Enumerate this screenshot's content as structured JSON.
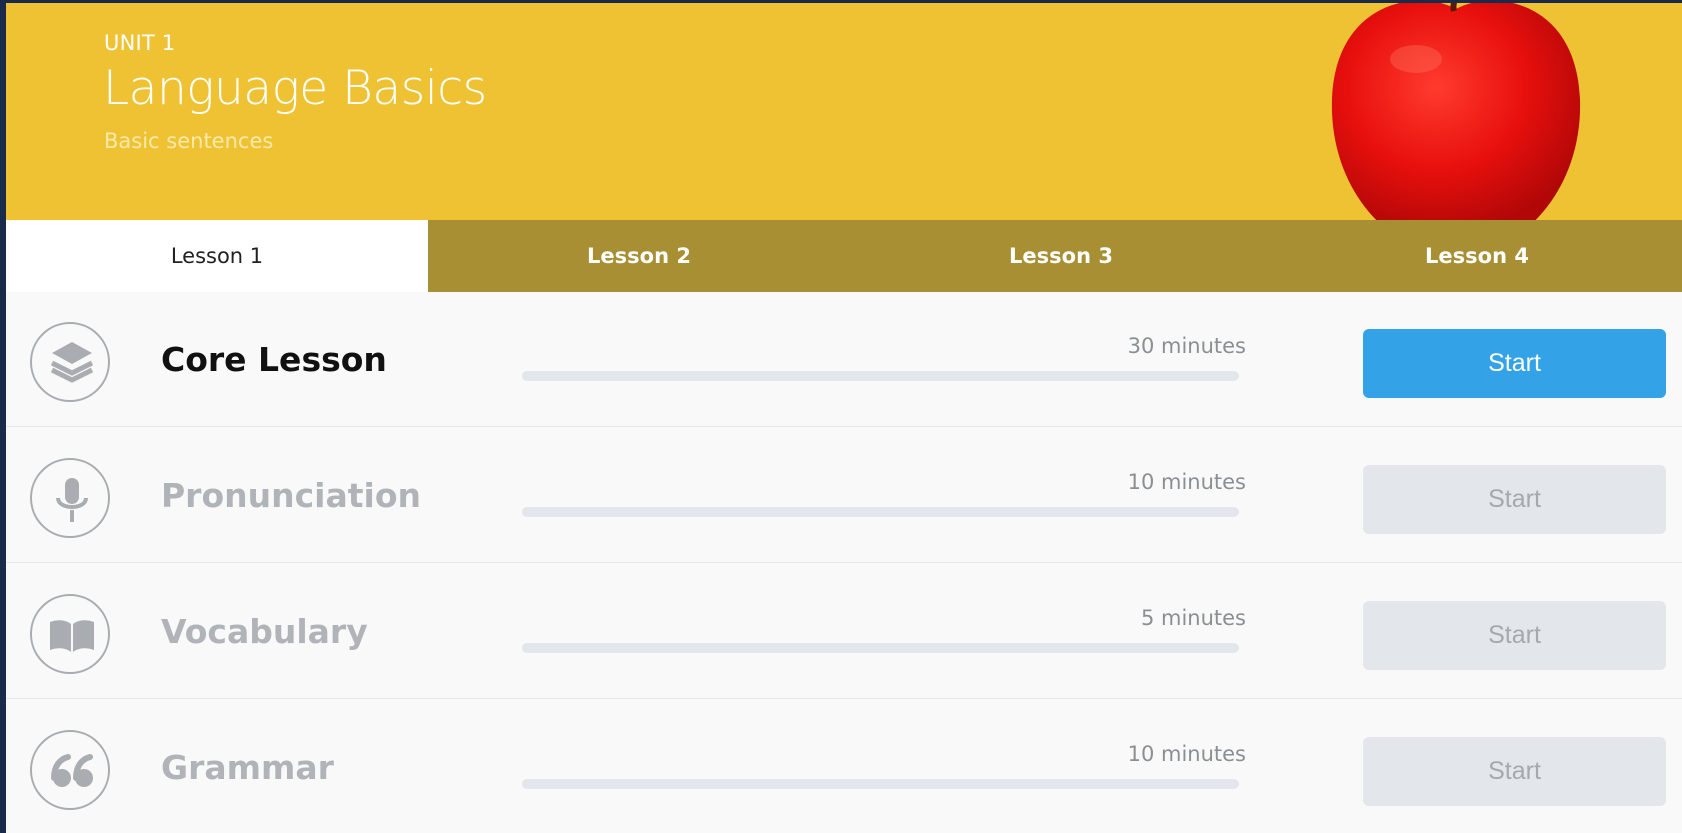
{
  "header": {
    "unit_label": "UNIT 1",
    "title": "Language Basics",
    "subtitle": "Basic sentences",
    "image": "apple"
  },
  "tabs": [
    {
      "label": "Lesson 1",
      "active": true
    },
    {
      "label": "Lesson 2",
      "active": false
    },
    {
      "label": "Lesson 3",
      "active": false
    },
    {
      "label": "Lesson 4",
      "active": false
    }
  ],
  "activities": [
    {
      "name": "Core Lesson",
      "duration": "30 minutes",
      "progress": 0,
      "button": "Start",
      "enabled": true,
      "icon": "layers-icon"
    },
    {
      "name": "Pronunciation",
      "duration": "10 minutes",
      "progress": 0,
      "button": "Start",
      "enabled": false,
      "icon": "microphone-icon"
    },
    {
      "name": "Vocabulary",
      "duration": "5 minutes",
      "progress": 0,
      "button": "Start",
      "enabled": false,
      "icon": "book-icon"
    },
    {
      "name": "Grammar",
      "duration": "10 minutes",
      "progress": 0,
      "button": "Start",
      "enabled": false,
      "icon": "quote-icon"
    }
  ],
  "colors": {
    "header_bg": "#efc234",
    "tab_bar_bg": "#a88f33",
    "accent_button": "#33a2e6",
    "disabled_button": "#e3e6ea"
  }
}
